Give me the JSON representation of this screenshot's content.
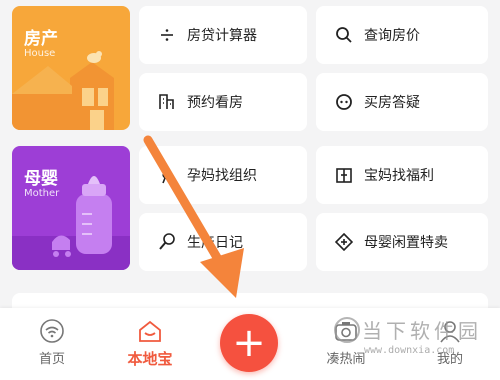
{
  "categories": {
    "house": {
      "title": "房产",
      "subtitle": "House",
      "color": "#f7a73a"
    },
    "mother": {
      "title": "母婴",
      "subtitle": "Mother",
      "color": "#9d3ed6"
    }
  },
  "tiles": {
    "mortgage_calc": {
      "label": "房贷计算器",
      "icon": "calculator-icon"
    },
    "query_price": {
      "label": "查询房价",
      "icon": "search-icon"
    },
    "book_viewing": {
      "label": "预约看房",
      "icon": "building-icon"
    },
    "house_qa": {
      "label": "买房答疑",
      "icon": "chat-icon"
    },
    "mom_groups": {
      "label": "孕妈找组织",
      "icon": "pregnant-icon"
    },
    "mom_welfare": {
      "label": "宝妈找福利",
      "icon": "gift-icon"
    },
    "birth_diary": {
      "label": "生产日记",
      "icon": "rattle-icon"
    },
    "baby_resale": {
      "label": "母婴闲置特卖",
      "icon": "resale-icon"
    }
  },
  "tabbar": {
    "home": "首页",
    "local": "本地宝",
    "plus": "+",
    "hot": "凑热闹",
    "mine": "我的"
  },
  "accent": "#f05a3e",
  "watermark": {
    "text": "当下软件园",
    "url": "www.downxia.com"
  }
}
